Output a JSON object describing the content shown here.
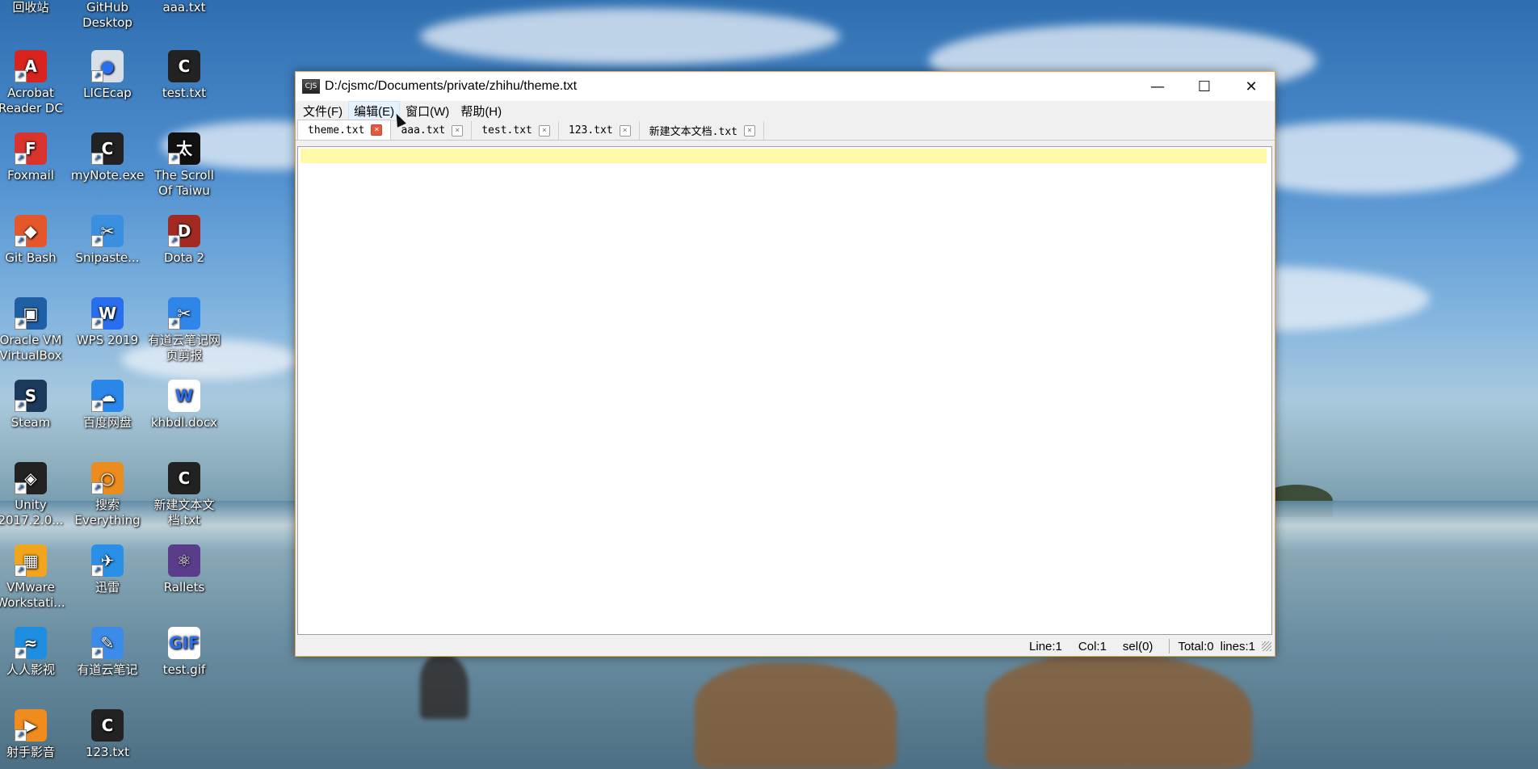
{
  "desktop": {
    "icons": [
      {
        "label": "回收站",
        "color": "#9fb7c9",
        "glyph": "♻",
        "shortcut": false
      },
      {
        "label": "GitHub Desktop",
        "color": "#6e5494",
        "glyph": "◉",
        "shortcut": false
      },
      {
        "label": "aaa.txt",
        "color": "#eeeeee",
        "glyph": "≡",
        "shortcut": false
      },
      {
        "label": "Acrobat Reader DC",
        "color": "#d9231f",
        "glyph": "A",
        "shortcut": true
      },
      {
        "label": "LICEcap",
        "color": "#d9dfe6",
        "glyph": "●",
        "shortcut": true
      },
      {
        "label": "test.txt",
        "color": "#222222",
        "glyph": "C",
        "shortcut": false
      },
      {
        "label": "Foxmail",
        "color": "#d8332c",
        "glyph": "F",
        "shortcut": true
      },
      {
        "label": "myNote.exe",
        "color": "#222222",
        "glyph": "C",
        "shortcut": true
      },
      {
        "label": "The Scroll Of Taiwu",
        "color": "#111111",
        "glyph": "太",
        "shortcut": true
      },
      {
        "label": "Git Bash",
        "color": "#e3572b",
        "glyph": "◆",
        "shortcut": true
      },
      {
        "label": "Snipaste...",
        "color": "#3a8fe0",
        "glyph": "✂",
        "shortcut": true
      },
      {
        "label": "Dota 2",
        "color": "#a32a22",
        "glyph": "D",
        "shortcut": true
      },
      {
        "label": "Oracle VM VirtualBox",
        "color": "#1f5fa6",
        "glyph": "▣",
        "shortcut": true
      },
      {
        "label": "WPS 2019",
        "color": "#2a6ef0",
        "glyph": "W",
        "shortcut": true
      },
      {
        "label": "有道云笔记网页剪报",
        "color": "#2f86e8",
        "glyph": "✂",
        "shortcut": true
      },
      {
        "label": "Steam",
        "color": "#1b3a5c",
        "glyph": "S",
        "shortcut": true
      },
      {
        "label": "百度网盘",
        "color": "#2a86e8",
        "glyph": "☁",
        "shortcut": true
      },
      {
        "label": "khbdl.docx",
        "color": "#ffffff",
        "glyph": "W",
        "shortcut": false
      },
      {
        "label": "Unity 2017.2.0...",
        "color": "#222222",
        "glyph": "◈",
        "shortcut": true
      },
      {
        "label": "搜索 Everything",
        "color": "#ec8b1e",
        "glyph": "○",
        "shortcut": true
      },
      {
        "label": "新建文本文档.txt",
        "color": "#222222",
        "glyph": "C",
        "shortcut": false
      },
      {
        "label": "VMware Workstati...",
        "color": "#f2a41c",
        "glyph": "▦",
        "shortcut": true
      },
      {
        "label": "迅雷",
        "color": "#2a8fe6",
        "glyph": "✈",
        "shortcut": true
      },
      {
        "label": "Rallets",
        "color": "#5a3d8a",
        "glyph": "⚛",
        "shortcut": false
      },
      {
        "label": "人人影视",
        "color": "#1d8ee0",
        "glyph": "≈",
        "shortcut": true
      },
      {
        "label": "有道云笔记",
        "color": "#3b8be8",
        "glyph": "✎",
        "shortcut": true
      },
      {
        "label": "test.gif",
        "color": "#ffffff",
        "glyph": "GIF",
        "shortcut": false
      },
      {
        "label": "射手影音",
        "color": "#f08b1e",
        "glyph": "▶",
        "shortcut": true
      },
      {
        "label": "123.txt",
        "color": "#222222",
        "glyph": "C",
        "shortcut": false
      }
    ]
  },
  "window": {
    "title": "D:/cjsmc/Documents/private/zhihu/theme.txt",
    "app_icon_text": "CJS",
    "menu": [
      "文件(F)",
      "编辑(E)",
      "窗口(W)",
      "帮助(H)"
    ],
    "tabs": [
      {
        "label": "theme.txt",
        "active": true
      },
      {
        "label": "aaa.txt",
        "active": false
      },
      {
        "label": "test.txt",
        "active": false
      },
      {
        "label": "123.txt",
        "active": false
      },
      {
        "label": "新建文本文档.txt",
        "active": false
      }
    ],
    "status": {
      "line": "Line:1",
      "col": "Col:1",
      "sel": "sel(0)",
      "total": "Total:0",
      "lines": "lines:1"
    },
    "controls": {
      "minimize": "—",
      "maximize": "☐",
      "close": "✕"
    },
    "tab_close_glyph": "×"
  },
  "colors": {
    "current_line": "#fff9a8",
    "window_border": "#e8a54d",
    "active_tab_close": "#e05a3b"
  }
}
